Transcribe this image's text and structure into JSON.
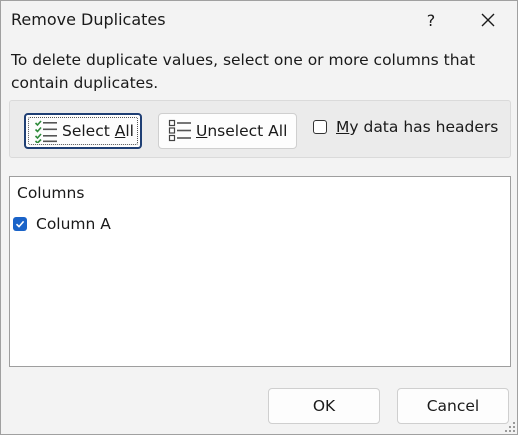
{
  "window": {
    "title": "Remove Duplicates",
    "help_label": "?"
  },
  "description": "To delete duplicate values, select one or more columns that contain duplicates.",
  "toolbar": {
    "select_all_prefix": "Select ",
    "select_all_accel": "A",
    "select_all_suffix": "ll",
    "unselect_all_accel": "U",
    "unselect_all_suffix": "nselect All",
    "headers_accel": "M",
    "headers_suffix": "y data has headers",
    "headers_checked": false
  },
  "columns": {
    "header": "Columns",
    "items": [
      {
        "label": "Column A",
        "checked": true
      }
    ]
  },
  "footer": {
    "ok_label": "OK",
    "cancel_label": "Cancel"
  },
  "colors": {
    "accent": "#1a63c8",
    "focus_border": "#1f3f74",
    "icon_green": "#2e8b3a"
  }
}
